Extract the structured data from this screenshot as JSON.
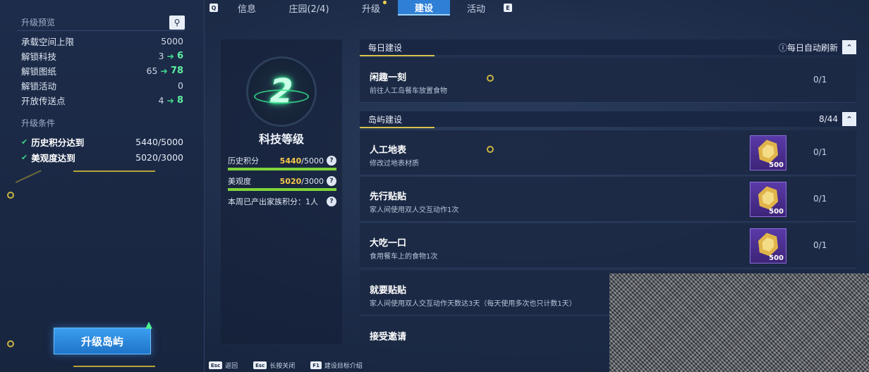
{
  "tabs": {
    "key_left": "Q",
    "key_right": "E",
    "items": [
      {
        "label": "信息"
      },
      {
        "label": "庄园(2/4)"
      },
      {
        "label": "升级"
      },
      {
        "label": "建设",
        "active": true
      },
      {
        "label": "活动"
      }
    ]
  },
  "preview": {
    "title": "升级预览",
    "rows": [
      {
        "label": "承载空间上限",
        "value": "5000",
        "new": ""
      },
      {
        "label": "解锁科技",
        "value": "3",
        "new": "6"
      },
      {
        "label": "解锁图纸",
        "value": "65",
        "new": "78"
      },
      {
        "label": "解锁活动",
        "value": "0",
        "new": ""
      },
      {
        "label": "开放传送点",
        "value": "4",
        "new": "8"
      }
    ]
  },
  "conditions": {
    "title": "升级条件",
    "rows": [
      {
        "label": "历史积分达到",
        "value": "5440/5000"
      },
      {
        "label": "美观度达到",
        "value": "5020/3000"
      }
    ]
  },
  "upgrade_button": "升级岛屿",
  "tech": {
    "level_number": "2",
    "title": "科技等级",
    "history_label": "历史积分",
    "history_value": "5440",
    "history_target": "/5000",
    "history_fill": 1.0,
    "beauty_label": "美观度",
    "beauty_value": "5020",
    "beauty_target": "/3000",
    "beauty_fill": 1.0,
    "weekly_text": "本周已产出家族积分：1人"
  },
  "daily": {
    "title": "每日建设",
    "refresh": "ⓘ每日自动刷新",
    "tasks": [
      {
        "name": "闲趣一刻",
        "desc": "前往人工岛餐车放置食物",
        "progress": "0/1"
      }
    ]
  },
  "island": {
    "title": "岛屿建设",
    "count": "8/44",
    "tasks": [
      {
        "name": "人工地表",
        "desc": "修改过地表材质",
        "progress": "0/1",
        "reward": "500"
      },
      {
        "name": "先行贴贴",
        "desc": "家人间使用双人交互动作1次",
        "progress": "0/1",
        "reward": "500"
      },
      {
        "name": "大吃一口",
        "desc": "食用餐车上的食物1次",
        "progress": "0/1",
        "reward": "500"
      },
      {
        "name": "就要贴贴",
        "desc": "家人间使用双人交互动作天数达3天（每天使用多次也只计数1天）",
        "progress": "",
        "reward": ""
      },
      {
        "name": "接受邀请",
        "desc": "",
        "progress": "",
        "reward": ""
      }
    ]
  },
  "bottom_bar": [
    {
      "key": "Esc",
      "label": "返回"
    },
    {
      "key": "Esc",
      "label": "长按关闭"
    },
    {
      "key": "F1",
      "label": "建设目标介绍"
    }
  ],
  "icons": {
    "search": "search-icon",
    "collapse": "chevron-up-icon",
    "check": "check-icon",
    "arrow": "arrow-right-icon",
    "help": "help-icon"
  },
  "colors": {
    "accent": "#2f7fd6",
    "green": "#3fd18a",
    "gold": "#d8c24a",
    "reward_bg": "#5a3aa8"
  }
}
